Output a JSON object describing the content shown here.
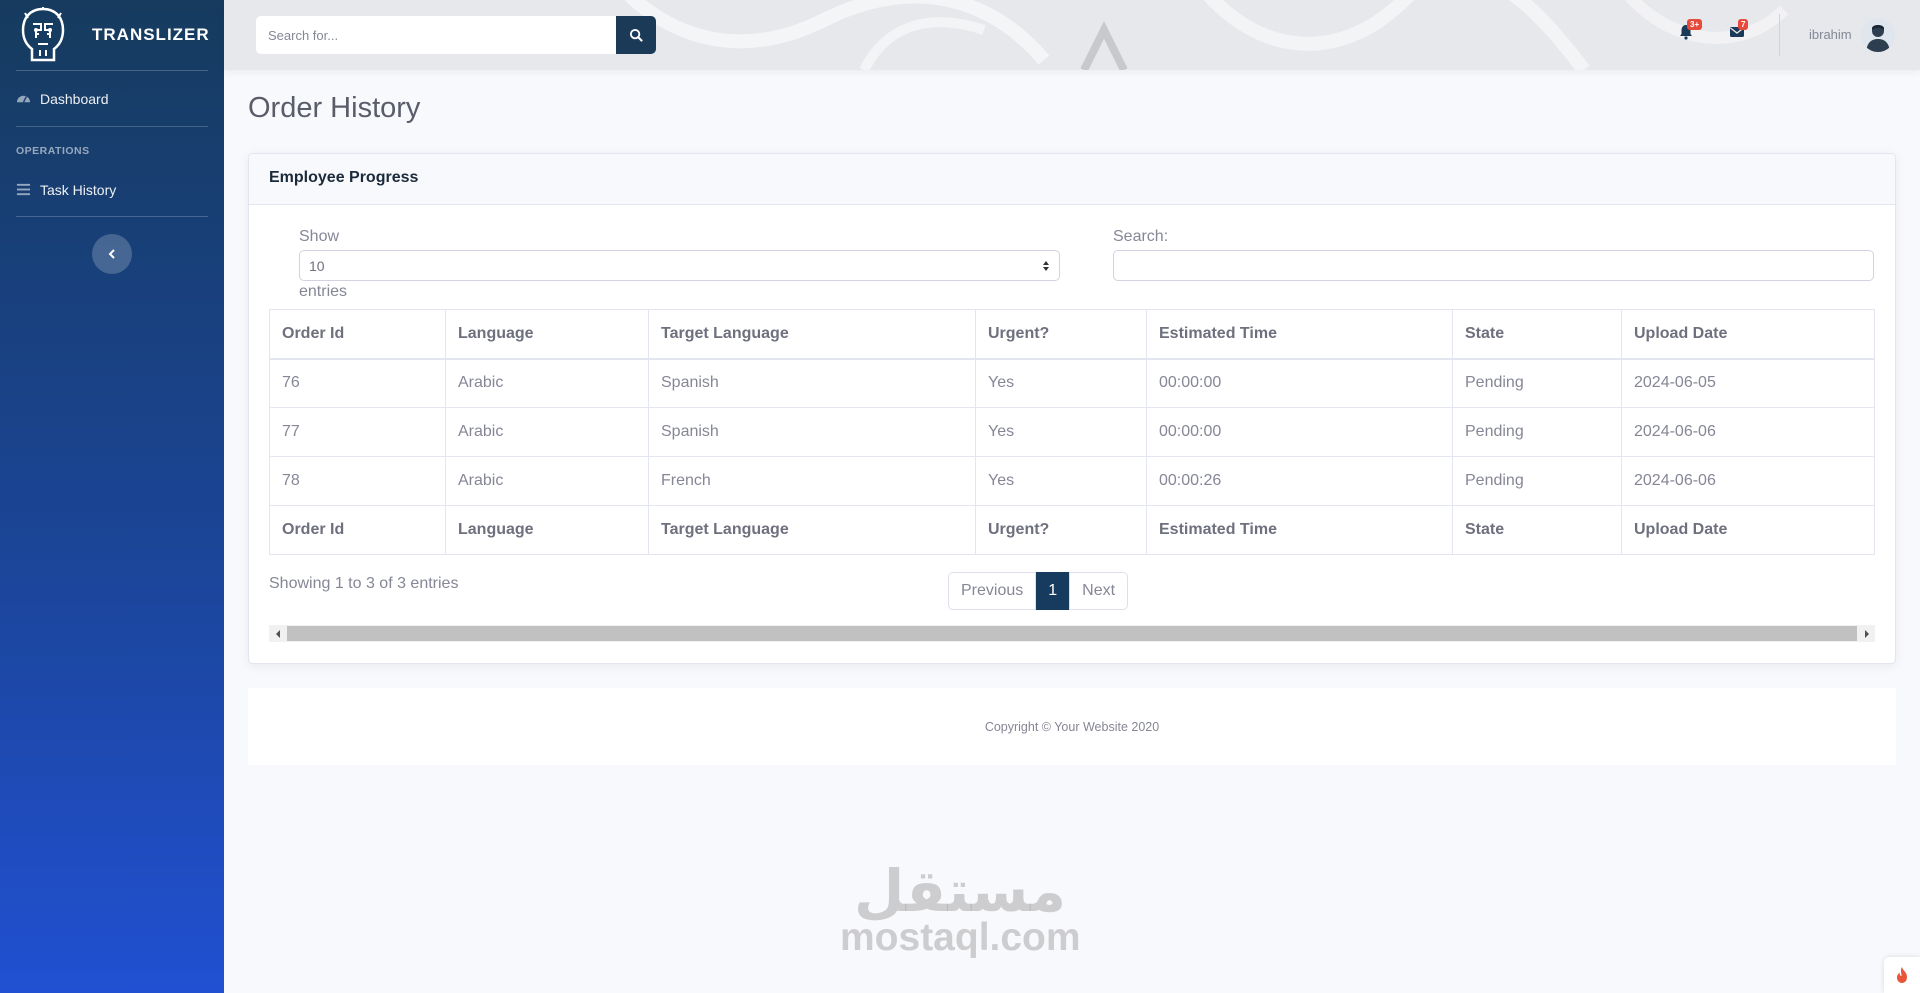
{
  "brand": {
    "name": "TRANSLIZER"
  },
  "sidebar": {
    "dashboard_label": "Dashboard",
    "heading": "OPERATIONS",
    "task_history_label": "Task History"
  },
  "topbar": {
    "search_placeholder": "Search for...",
    "alerts_badge": "3+",
    "messages_badge": "7",
    "user_name": "ibrahim"
  },
  "page": {
    "title": "Order History"
  },
  "card": {
    "title": "Employee Progress",
    "length": {
      "show_label": "Show",
      "selected": "10",
      "entries_label": "entries"
    },
    "filter_label": "Search:",
    "columns": [
      "Order Id",
      "Language",
      "Target Language",
      "Urgent?",
      "Estimated Time",
      "State",
      "Upload Date"
    ],
    "rows": [
      [
        "76",
        "Arabic",
        "Spanish",
        "Yes",
        "00:00:00",
        "Pending",
        "2024-06-05"
      ],
      [
        "77",
        "Arabic",
        "Spanish",
        "Yes",
        "00:00:00",
        "Pending",
        "2024-06-06"
      ],
      [
        "78",
        "Arabic",
        "French",
        "Yes",
        "00:00:26",
        "Pending",
        "2024-06-06"
      ]
    ],
    "info": "Showing 1 to 3 of 3 entries",
    "pagination": {
      "previous": "Previous",
      "current": "1",
      "next": "Next"
    }
  },
  "footer": {
    "copyright": "Copyright © Your Website 2020"
  },
  "watermark": {
    "arabic": "مستقل",
    "latin": "mostaql.com"
  },
  "colors": {
    "sidebar_top": "#163b5e",
    "sidebar_bottom": "#2150d2",
    "accent": "#163b5e",
    "badge": "#e74a3b"
  },
  "icons": [
    "brand-logo-icon",
    "tachometer-icon",
    "list-icon",
    "chevron-left-icon",
    "search-icon",
    "bell-icon",
    "envelope-icon",
    "user-avatar-icon",
    "sort-icon",
    "fire-icon"
  ]
}
